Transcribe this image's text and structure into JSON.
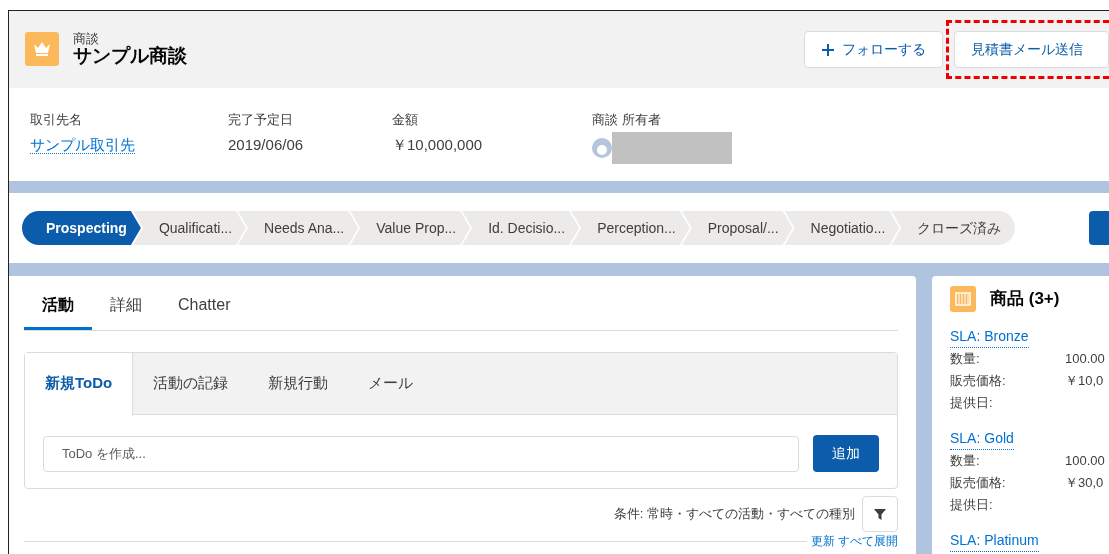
{
  "record": {
    "object_label": "商談",
    "title": "サンプル商談"
  },
  "actions": [
    {
      "label": "フォローする",
      "kind": "follow",
      "highlighted": false
    },
    {
      "label": "見積書メール送信",
      "kind": "plain",
      "highlighted": true
    }
  ],
  "fields": [
    {
      "label": "取引先名",
      "value": "サンプル取引先",
      "kind": "link"
    },
    {
      "label": "完了予定日",
      "value": "2019/06/06",
      "kind": "text"
    },
    {
      "label": "金額",
      "value": "￥10,000,000",
      "kind": "text"
    },
    {
      "label": "商談 所有者",
      "kind": "user"
    }
  ],
  "path": [
    {
      "label": "Prospecting",
      "selected": true
    },
    {
      "label": "Qualificati...",
      "selected": false
    },
    {
      "label": "Needs Ana...",
      "selected": false
    },
    {
      "label": "Value Prop...",
      "selected": false
    },
    {
      "label": "Id. Decisio...",
      "selected": false
    },
    {
      "label": "Perception...",
      "selected": false
    },
    {
      "label": "Proposal/...",
      "selected": false
    },
    {
      "label": "Negotiatio...",
      "selected": false
    },
    {
      "label": "クローズ済み",
      "selected": false
    }
  ],
  "tabs": [
    {
      "label": "活動",
      "selected": true
    },
    {
      "label": "詳細",
      "selected": false
    },
    {
      "label": "Chatter",
      "selected": false
    }
  ],
  "activity_tabs": [
    {
      "label": "新規ToDo",
      "selected": true
    },
    {
      "label": "活動の記録",
      "selected": false
    },
    {
      "label": "新規行動",
      "selected": false
    },
    {
      "label": "メール",
      "selected": false
    }
  ],
  "todo": {
    "placeholder": "ToDo を作成...",
    "button": "追加"
  },
  "filter": "条件: 常時・すべての活動・すべての種別",
  "links": [
    "更新",
    "すべて展開"
  ],
  "products": {
    "title": "商品 (3+)",
    "items": [
      {
        "name": "SLA: Bronze",
        "fields": [
          {
            "label": "数量:",
            "value": "100.00"
          },
          {
            "label": "販売価格:",
            "value": "￥10,0"
          },
          {
            "label": "提供日:"
          }
        ]
      },
      {
        "name": "SLA: Gold",
        "fields": [
          {
            "label": "数量:",
            "value": "100.00"
          },
          {
            "label": "販売価格:",
            "value": "￥30,0"
          },
          {
            "label": "提供日:"
          }
        ]
      },
      {
        "name": "SLA: Platinum"
      }
    ]
  }
}
